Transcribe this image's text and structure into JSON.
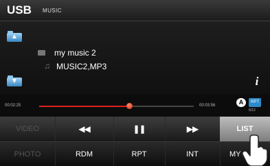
{
  "header": {
    "source": "USB",
    "mode": "MUSIC"
  },
  "browser": {
    "folder": {
      "name": "my music 2",
      "icon": "folder-icon"
    },
    "file": {
      "name": "MUSIC2,MP3",
      "icon": "music-note-icon"
    },
    "folder_up_icon": "folder-up-icon",
    "folder_down_icon": "folder-down-icon",
    "info_label": "i"
  },
  "playback": {
    "elapsed": "00:02:25",
    "total": "00:03:56",
    "progress_fraction": 0.58,
    "badge_a": "A",
    "badge_rpt": "RPT",
    "track_count": "6/12",
    "progress_color": "#e02020"
  },
  "controls": {
    "video_label": "VIDEO",
    "prev_icon": "previous-track-icon",
    "pause_icon": "pause-icon",
    "next_icon": "next-track-icon",
    "list_label": "LIST"
  },
  "modes": {
    "photo_label": "PHOTO",
    "rdm_label": "RDM",
    "rpt_label": "RPT",
    "int_label": "INT",
    "my_label": "MY"
  }
}
